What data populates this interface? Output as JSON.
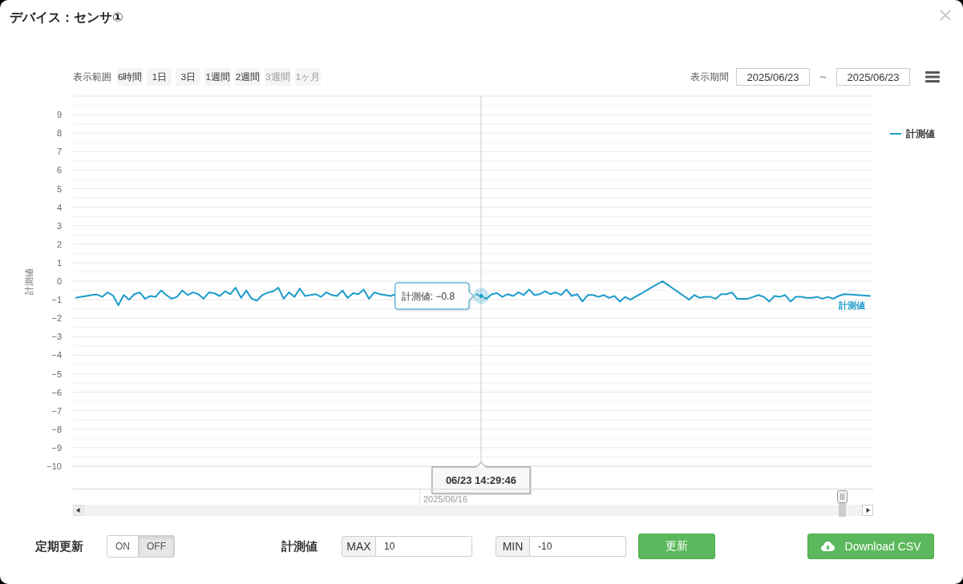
{
  "dialog": {
    "title": "デバイス：センサ①"
  },
  "range_selector": {
    "label": "表示範囲",
    "buttons": [
      {
        "label": "6時間",
        "selected": false,
        "disabled": false
      },
      {
        "label": "1日",
        "selected": false,
        "disabled": false
      },
      {
        "label": "3日",
        "selected": false,
        "disabled": false
      },
      {
        "label": "1週間",
        "selected": false,
        "disabled": false
      },
      {
        "label": "2週間",
        "selected": false,
        "disabled": false
      },
      {
        "label": "3週間",
        "selected": false,
        "disabled": true
      },
      {
        "label": "1ヶ月",
        "selected": false,
        "disabled": true
      }
    ]
  },
  "period": {
    "label": "表示期間",
    "from": "2025/06/23",
    "separator": "～",
    "to": "2025/06/23"
  },
  "chart": {
    "chart_data": {
      "type": "line",
      "ylabel": "計測値",
      "ylim": [
        -10,
        10
      ],
      "grid": true,
      "yticks": [
        9,
        8,
        7,
        6,
        5,
        4,
        3,
        2,
        1,
        0,
        {
          "value": -1,
          "label": "−1"
        },
        {
          "value": -2,
          "label": "−2"
        },
        {
          "value": -3,
          "label": "−3"
        },
        {
          "value": -4,
          "label": "−4"
        },
        {
          "value": -5,
          "label": "−5"
        },
        {
          "value": -6,
          "label": "−6"
        },
        {
          "value": -7,
          "label": "−7"
        },
        {
          "value": -8,
          "label": "−8"
        },
        {
          "value": -9,
          "label": "−9"
        },
        {
          "value": -10,
          "label": "−10"
        }
      ],
      "categories": [
        null,
        null,
        null,
        null,
        null,
        null,
        null,
        null,
        null,
        null,
        null,
        null,
        null,
        null,
        null,
        null,
        null,
        null,
        null,
        null,
        null,
        null,
        null,
        null,
        null,
        null,
        null,
        null,
        null,
        null,
        null,
        null,
        null,
        null,
        null,
        null,
        null,
        null,
        null,
        null,
        null,
        null,
        null,
        null,
        null,
        null,
        null,
        null,
        null,
        null,
        null,
        null,
        null,
        null,
        null,
        null,
        null,
        null,
        null,
        null,
        null,
        null,
        null,
        null,
        null,
        null,
        null,
        null,
        null,
        null,
        null,
        null,
        null,
        null,
        null,
        null,
        "06/23 14:29:46",
        null,
        null,
        null,
        null,
        null,
        null,
        null,
        null,
        null,
        null,
        null,
        null,
        null,
        null,
        null,
        null,
        null,
        null,
        null,
        null,
        null,
        null,
        null,
        null,
        null,
        null,
        null,
        null,
        null,
        null,
        null,
        null,
        null,
        null,
        null,
        null,
        null,
        null,
        null,
        null,
        null,
        null,
        null,
        null,
        null,
        null,
        null,
        null,
        null,
        null,
        null,
        null,
        null,
        null,
        null,
        null,
        null,
        null,
        null,
        null,
        null,
        null,
        null,
        null,
        null,
        null,
        null,
        null,
        null,
        null,
        null,
        null,
        null
      ],
      "series": [
        {
          "name": "計測値",
          "color": "#1a9bc9",
          "values": [
            -0.9,
            -0.85,
            -0.8,
            -0.75,
            -0.72,
            -0.85,
            -0.6,
            -0.78,
            -1.3,
            -0.75,
            -1.0,
            -0.7,
            -0.6,
            -0.95,
            -0.8,
            -0.85,
            -0.5,
            -0.75,
            -0.95,
            -0.85,
            -0.5,
            -0.75,
            -0.6,
            -0.7,
            -0.95,
            -0.6,
            -0.65,
            -0.8,
            -0.55,
            -0.7,
            -0.35,
            -0.9,
            -0.5,
            -0.95,
            -1.05,
            -0.75,
            -0.62,
            -0.55,
            -0.35,
            -0.95,
            -0.6,
            -0.85,
            -0.4,
            -0.8,
            -0.75,
            -0.7,
            -0.85,
            -0.6,
            -0.75,
            -0.8,
            -0.5,
            -0.9,
            -0.65,
            -0.7,
            -0.45,
            -0.95,
            -0.6,
            -0.7,
            -0.75,
            -0.8,
            -0.7,
            null,
            null,
            null,
            null,
            null,
            null,
            null,
            null,
            null,
            null,
            null,
            null,
            null,
            null,
            -0.7,
            -0.8,
            -0.95,
            -0.7,
            -0.65,
            -0.85,
            -0.7,
            -0.8,
            -0.6,
            -0.75,
            -0.45,
            -0.75,
            -0.7,
            -0.55,
            -0.7,
            -0.6,
            -0.75,
            -0.45,
            -0.8,
            -0.7,
            -1.1,
            -0.75,
            -0.75,
            -0.85,
            -0.75,
            -0.9,
            -0.8,
            -1.1,
            -0.85,
            -1.0,
            -0.83,
            -0.67,
            -0.5,
            -0.33,
            -0.17,
            0,
            -0.2,
            -0.4,
            -0.6,
            -0.8,
            -1.0,
            -0.75,
            -0.9,
            -0.85,
            -0.85,
            -0.95,
            -0.7,
            -0.7,
            -0.6,
            -0.95,
            -0.95,
            -0.95,
            -0.85,
            -0.75,
            -0.85,
            -1.1,
            -0.8,
            -0.85,
            -0.75,
            -1.1,
            -0.85,
            -0.85,
            -0.9,
            -0.9,
            -0.85,
            -0.95,
            -0.85,
            -0.95,
            -0.8,
            -0.7,
            -0.72,
            -0.74,
            -0.76,
            -0.78,
            -0.8
          ]
        }
      ],
      "annotations": [
        "計測値: −0.8"
      ]
    },
    "series_label": "計測値",
    "navigator": {
      "label": "2025/06/16"
    }
  },
  "controls": {
    "auto_update": {
      "label": "定期更新",
      "options": [
        {
          "label": "ON",
          "selected": false
        },
        {
          "label": "OFF",
          "selected": true
        }
      ]
    },
    "range": {
      "label": "計測値",
      "max": {
        "addon": "MAX",
        "value": "10"
      },
      "min": {
        "addon": "MIN",
        "value": "-10"
      }
    },
    "update_button": "更新",
    "download_button": "Download CSV"
  }
}
